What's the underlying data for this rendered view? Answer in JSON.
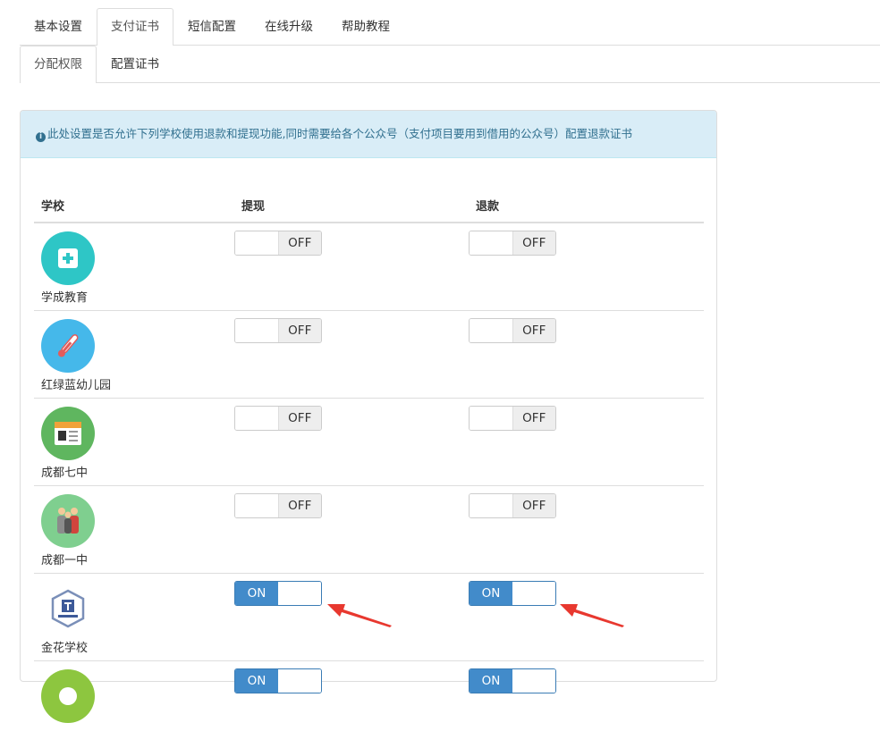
{
  "tabs": [
    {
      "label": "基本设置",
      "active": false
    },
    {
      "label": "支付证书",
      "active": true
    },
    {
      "label": "短信配置",
      "active": false
    },
    {
      "label": "在线升级",
      "active": false
    },
    {
      "label": "帮助教程",
      "active": false
    }
  ],
  "subtabs": [
    {
      "label": "分配权限",
      "active": true
    },
    {
      "label": "配置证书",
      "active": false
    }
  ],
  "alert": {
    "text": "此处设置是否允许下列学校使用退款和提现功能,同时需要给各个公众号（支付项目要用到借用的公众号）配置退款证书",
    "icon": "info-circle-icon"
  },
  "table": {
    "headers": {
      "school": "学校",
      "withdraw": "提现",
      "refund": "退款"
    },
    "rows": [
      {
        "name": "学成教育",
        "logo": "medical-kit-icon",
        "logo_color": "#2ec6c6",
        "withdraw": "OFF",
        "refund": "OFF"
      },
      {
        "name": "红绿蓝幼儿园",
        "logo": "thermometer-icon",
        "logo_color": "#45b8ea",
        "withdraw": "OFF",
        "refund": "OFF"
      },
      {
        "name": "成都七中",
        "logo": "newspaper-icon",
        "logo_color": "#5fb65f",
        "withdraw": "OFF",
        "refund": "OFF"
      },
      {
        "name": "成都一中",
        "logo": "people-group-icon",
        "logo_color": "#7fcf8f",
        "withdraw": "OFF",
        "refund": "OFF"
      },
      {
        "name": "金花学校",
        "logo": "school-badge-icon",
        "logo_color": "#ffffff",
        "withdraw": "ON",
        "refund": "ON"
      },
      {
        "name": "",
        "logo": "school-logo-icon",
        "logo_color": "#8dc63f",
        "withdraw": "ON",
        "refund": "ON"
      }
    ]
  },
  "switch_labels": {
    "on": "ON",
    "off": "OFF"
  },
  "colors": {
    "on": "#428bca",
    "arrow": "#e8382f"
  }
}
